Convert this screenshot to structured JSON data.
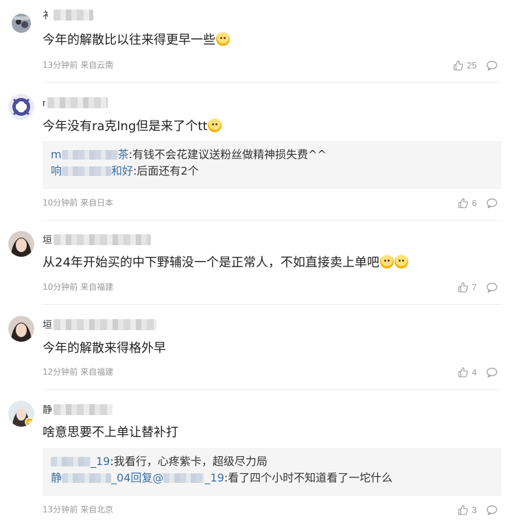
{
  "comments": [
    {
      "name_visible": "衤",
      "text": "今年的解散比以往来得更早一些",
      "emoji": true,
      "emoji_count": 1,
      "time": "13分钟前",
      "source": "来自云南",
      "likes": "25",
      "replies": []
    },
    {
      "name_visible": "r",
      "text": "今年没有ra克lng但是来了个tt",
      "emoji": true,
      "emoji_count": 1,
      "time": "10分钟前",
      "source": "来自日本",
      "likes": "6",
      "replies": [
        {
          "prefix": "m",
          "prefix_tail": "茶",
          "body": ":有钱不会花建议送粉丝做精神损失费^^"
        },
        {
          "prefix": "响",
          "prefix_tail": "和好",
          "body": ":后面还有2个"
        }
      ]
    },
    {
      "name_visible": "垣",
      "text": "从24年开始买的中下野辅没一个是正常人，不如直接卖上单吧",
      "emoji": true,
      "emoji_count": 2,
      "time": "10分钟前",
      "source": "来自福建",
      "likes": "7",
      "replies": []
    },
    {
      "name_visible": "垣",
      "text": "今年的解散来得格外早",
      "emoji": false,
      "emoji_count": 0,
      "time": "12分钟前",
      "source": "来自福建",
      "likes": "4",
      "replies": []
    },
    {
      "name_visible": "静",
      "text": "啥意思要不上单让替补打",
      "emoji": false,
      "emoji_count": 0,
      "time": "13分钟前",
      "source": "来自北京",
      "likes": "3",
      "replies": [
        {
          "prefix": "",
          "prefix_tail": "_19",
          "body": ":我看行，心疼紫卡，超级尽力局"
        },
        {
          "prefix": "静",
          "prefix_tail": "_04回复@",
          "prefix_tail2": "_19",
          "body": ":看了四个小时不知道看了一坨什么"
        }
      ]
    }
  ],
  "colors": {
    "link": "#3a6ea5",
    "meta": "#999999",
    "reply_bg": "#f5f5f5"
  },
  "icons": {
    "like": "thumbs-up-icon",
    "reply": "comment-bubble-icon"
  }
}
